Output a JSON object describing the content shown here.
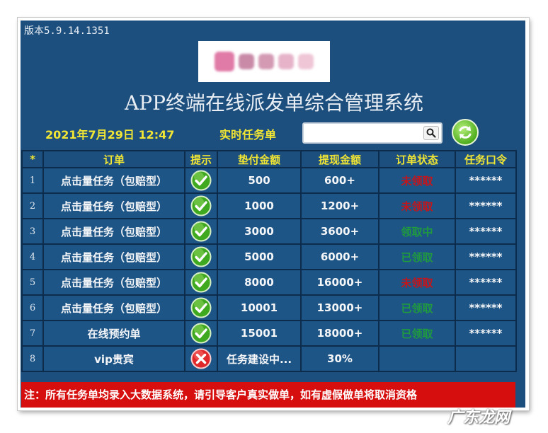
{
  "version": "版本5.9.14.1351",
  "title": "APP终端在线派发单综合管理系统",
  "datetime": "2021年7月29日 12:47",
  "task_label": "实时任务单",
  "search": {
    "placeholder": "",
    "value": ""
  },
  "colors": {
    "panel": "#1c4f7d",
    "header_text": "#f2e634",
    "status_red": "#c4151a",
    "status_green": "#1f9a3e",
    "note_bg": "#d60e0e"
  },
  "table": {
    "headers": [
      "*",
      "订单",
      "提示",
      "垫付金额",
      "提现金额",
      "订单状态",
      "任务口令"
    ],
    "rows": [
      {
        "no": "1",
        "order": "点击量任务（包赔型）",
        "icon": "check-icon",
        "deposit": "500",
        "withdraw": "600+",
        "status": "未领取",
        "status_color": "#c4151a",
        "code": "******"
      },
      {
        "no": "2",
        "order": "点击量任务（包赔型）",
        "icon": "check-icon",
        "deposit": "1000",
        "withdraw": "1200+",
        "status": "未领取",
        "status_color": "#c4151a",
        "code": "******"
      },
      {
        "no": "3",
        "order": "点击量任务（包赔型）",
        "icon": "check-icon",
        "deposit": "3000",
        "withdraw": "3600+",
        "status": "领取中",
        "status_color": "#1f9a3e",
        "code": "******"
      },
      {
        "no": "4",
        "order": "点击量任务（包赔型）",
        "icon": "check-icon",
        "deposit": "5000",
        "withdraw": "6000+",
        "status": "已领取",
        "status_color": "#1f9a3e",
        "code": "******"
      },
      {
        "no": "5",
        "order": "点击量任务（包赔型）",
        "icon": "check-icon",
        "deposit": "8000",
        "withdraw": "16000+",
        "status": "未领取",
        "status_color": "#c4151a",
        "code": "******"
      },
      {
        "no": "6",
        "order": "点击量任务（包赔型）",
        "icon": "check-icon",
        "deposit": "10001",
        "withdraw": "13000+",
        "status": "已领取",
        "status_color": "#1f9a3e",
        "code": "******"
      },
      {
        "no": "7",
        "order": "在线预约单",
        "icon": "check-icon",
        "deposit": "15001",
        "withdraw": "18000+",
        "status": "已领取",
        "status_color": "#1f9a3e",
        "code": "******"
      },
      {
        "no": "8",
        "order": "vip贵宾",
        "icon": "cross-icon",
        "deposit": "任务建设中...",
        "withdraw": "30%",
        "status": "",
        "status_color": "#1f9a3e",
        "code": ""
      }
    ]
  },
  "note": "注：所有任务单均录入大数据系统，请引导客户真实做单，如有虚假做单将取消资格",
  "watermark": "广东龙网"
}
